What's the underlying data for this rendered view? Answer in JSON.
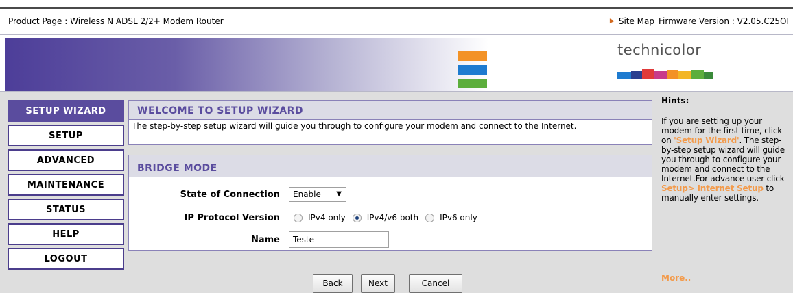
{
  "header": {
    "product": "Product Page : Wireless N ADSL 2/2+ Modem Router",
    "site_map": "Site Map",
    "firmware": "Firmware Version : V2.05.C25OI",
    "logo": "technicolor"
  },
  "nav": {
    "items": [
      {
        "label": "SETUP WIZARD",
        "active": true
      },
      {
        "label": "SETUP"
      },
      {
        "label": "ADVANCED"
      },
      {
        "label": "MAINTENANCE"
      },
      {
        "label": "STATUS"
      },
      {
        "label": "HELP"
      },
      {
        "label": "LOGOUT"
      }
    ]
  },
  "welcome": {
    "title": "WELCOME TO SETUP WIZARD",
    "text": "The step-by-step setup wizard will guide you through to configure your modem and connect to the Internet."
  },
  "bridge": {
    "title": "BRIDGE MODE",
    "state_label": "State of Connection",
    "state_value": "Enable",
    "ip_label": "IP Protocol Version",
    "ip_options": [
      "IPv4 only",
      "IPv4/v6 both",
      "IPv6 only"
    ],
    "ip_selected": "IPv4/v6 both",
    "name_label": "Name",
    "name_value": "Teste"
  },
  "buttons": {
    "back": "Back",
    "next": "Next",
    "cancel": "Cancel"
  },
  "hints": {
    "title": "Hints:",
    "p1": "If you are setting up your modem for the first time, click on ",
    "link1": "'Setup Wizard'",
    "p2": ". The step-by-step setup wizard will guide you through to configure your modem and connect to the Internet.For advance user click ",
    "link2": "Setup> Internet Setup",
    "p3": " to manually enter settings.",
    "more": "More.."
  },
  "colors": {
    "accent": "#5a4c9e",
    "hint_highlight": "#f39a4a",
    "stripe_orange": "#f39226",
    "stripe_blue": "#1e7bd0",
    "stripe_green": "#5cae3c"
  }
}
